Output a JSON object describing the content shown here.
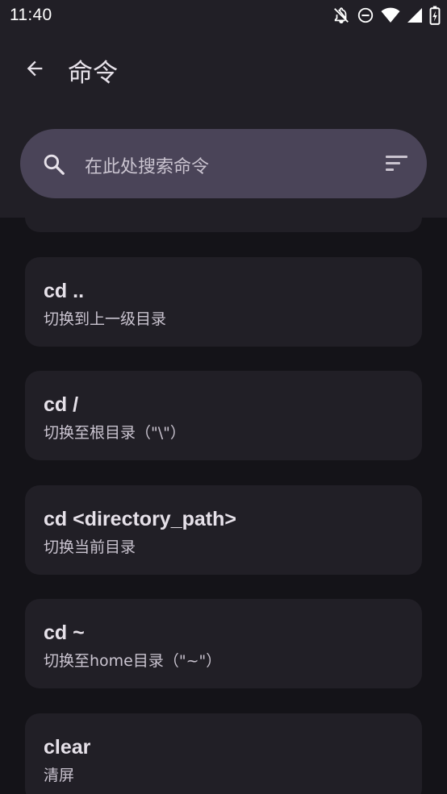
{
  "status_bar": {
    "time": "11:40",
    "icons": [
      "notifications-off-icon",
      "do-not-disturb-icon",
      "wifi-icon",
      "cell-signal-icon",
      "battery-charging-icon"
    ]
  },
  "app_bar": {
    "back_icon": "arrow-back-icon",
    "title": "命令"
  },
  "search": {
    "placeholder": "在此处搜索命令",
    "icon": "search-icon",
    "sort_icon": "sort-icon"
  },
  "colors": {
    "background": "#141318",
    "surface": "#211f26",
    "search_bar": "#4a4458",
    "text_primary": "#e6e1e9",
    "text_secondary": "#cac4d0"
  },
  "commands": [
    {
      "command": "",
      "description": ""
    },
    {
      "command": "cd ..",
      "description": "切换到上一级目录"
    },
    {
      "command": "cd /",
      "description": "切换至根目录（\"\\\"）"
    },
    {
      "command": "cd <directory_path>",
      "description": "切换当前目录"
    },
    {
      "command": "cd ~",
      "description": "切换至home目录（\"~\"）"
    },
    {
      "command": "clear",
      "description": "清屏"
    }
  ]
}
